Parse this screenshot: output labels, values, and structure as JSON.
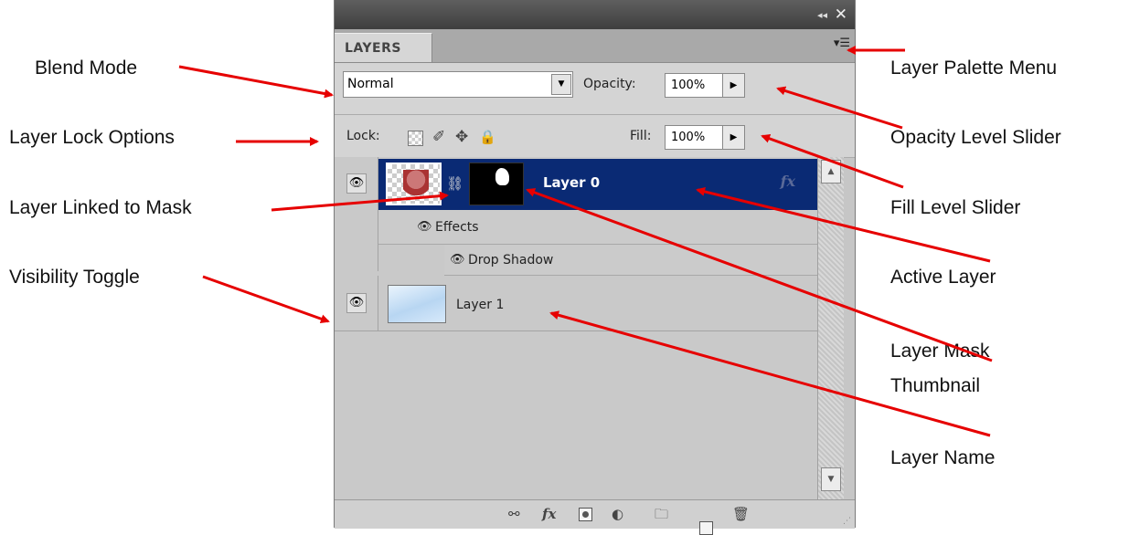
{
  "panel": {
    "tab_label": "LAYERS",
    "collapse_glyph": "◂◂",
    "close_glyph": "✕",
    "menu_glyph": "▾☰",
    "blend_mode": "Normal",
    "opacity_label": "Opacity:",
    "opacity_value": "100%",
    "lock_label": "Lock:",
    "fill_label": "Fill:",
    "fill_value": "100%",
    "lock_icons": [
      "transparency-lock-icon",
      "brush-lock-icon",
      "move-lock-icon",
      "padlock-icon"
    ],
    "layers": [
      {
        "name": "Layer 0",
        "active": true,
        "has_mask": true,
        "linked": true,
        "effects_label": "Effects",
        "effect": "Drop Shadow"
      },
      {
        "name": "Layer 1",
        "active": false
      }
    ],
    "fx_glyph": "fx",
    "bottom_icons": [
      "link-layers-icon",
      "fx-icon",
      "add-mask-icon",
      "adjustment-layer-icon",
      "new-group-icon",
      "new-layer-icon",
      "trash-icon"
    ]
  },
  "callouts": {
    "blend_mode": "Blend Mode",
    "lock_options": "Layer Lock Options",
    "linked_mask": "Layer Linked to Mask",
    "visibility": "Visibility Toggle",
    "palette_menu": "Layer Palette Menu",
    "opacity_slider": "Opacity Level Slider",
    "fill_slider": "Fill Level Slider",
    "active_layer": "Active Layer",
    "mask_thumb_line1": "Layer Mask",
    "mask_thumb_line2": "Thumbnail",
    "layer_name": "Layer Name"
  },
  "colors": {
    "arrow": "#e60000",
    "active_layer": "#0a2a74"
  }
}
